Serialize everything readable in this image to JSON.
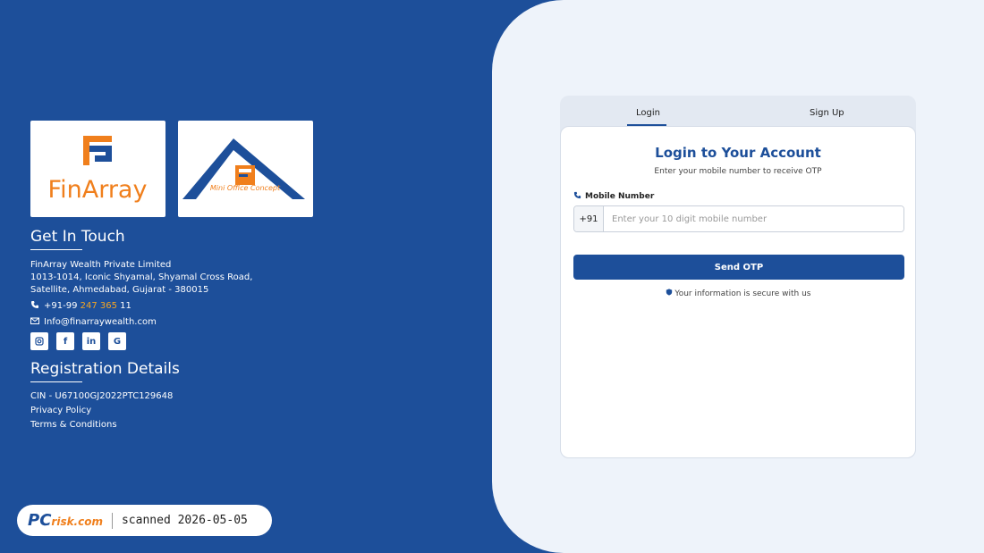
{
  "logos": [
    {
      "name": "FinArray",
      "label": "FinArray"
    },
    {
      "name": "Mini Office Concept",
      "label": "Mini Office Concept"
    }
  ],
  "contact": {
    "heading": "Get In Touch",
    "company": "FinArray Wealth Private Limited",
    "address_line1": "1013-1014, Iconic Shyamal, Shyamal Cross Road,",
    "address_line2": "Satellite, Ahmedabad, Gujarat - 380015",
    "phone_prefix": "+91-99",
    "phone_highlight": "247 365",
    "phone_suffix": "11",
    "email": "Info@finarraywealth.com",
    "socials": [
      "instagram",
      "facebook",
      "linkedin",
      "google"
    ]
  },
  "registration": {
    "heading": "Registration Details",
    "cin": "CIN - U67100GJ2022PTC129648",
    "privacy": "Privacy Policy",
    "terms": "Terms & Conditions"
  },
  "auth": {
    "tabs": [
      "Login",
      "Sign Up"
    ],
    "active_tab": "Login",
    "title": "Login to Your Account",
    "subtitle": "Enter your mobile number to receive OTP",
    "field_label": "Mobile Number",
    "country_code": "+91",
    "placeholder": "Enter your 10 digit mobile number",
    "button": "Send OTP",
    "secure_note": "Your information is secure with us"
  },
  "watermark": {
    "brand_main": "PC",
    "brand_sub": "risk.com",
    "text": "scanned 2026-05-05"
  },
  "colors": {
    "primary": "#1d4f9a",
    "accent": "#f5a623",
    "panel": "#eef3fa"
  }
}
